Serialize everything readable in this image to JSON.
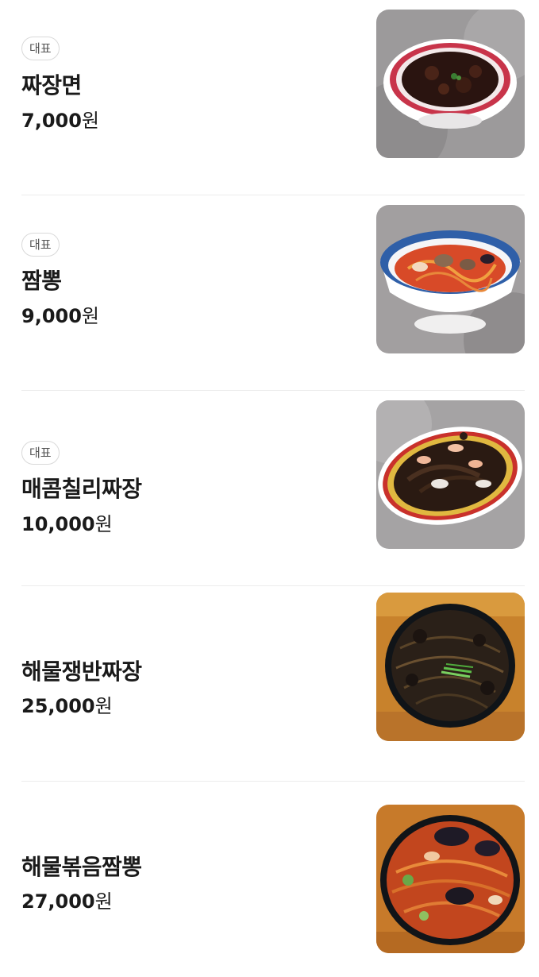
{
  "menu": {
    "items": [
      {
        "badge": "대표",
        "name": "짜장면",
        "price": "7,000",
        "unit": "원",
        "image": "jjajangmyeon-photo"
      },
      {
        "badge": "대표",
        "name": "짬뽕",
        "price": "9,000",
        "unit": "원",
        "image": "jjamppong-photo"
      },
      {
        "badge": "대표",
        "name": "매콤칠리짜장",
        "price": "10,000",
        "unit": "원",
        "image": "spicy-chili-jjajang-photo"
      },
      {
        "badge": "",
        "name": "해물쟁반짜장",
        "price": "25,000",
        "unit": "원",
        "image": "seafood-jaengban-jjajang-photo"
      },
      {
        "badge": "",
        "name": "해물볶음짬뽕",
        "price": "27,000",
        "unit": "원",
        "image": "seafood-stirfry-jjamppong-photo"
      }
    ]
  }
}
